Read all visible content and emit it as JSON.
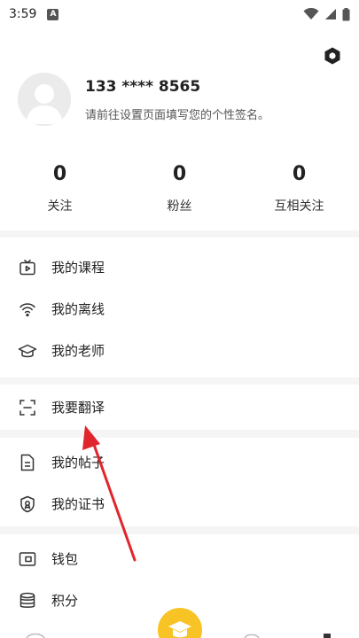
{
  "status_bar": {
    "time": "3:59",
    "notification_letter": "A"
  },
  "profile": {
    "name": "133 **** 8565",
    "signature": "请前往设置页面填写您的个性签名。",
    "stats": [
      {
        "value": "0",
        "label": "关注"
      },
      {
        "value": "0",
        "label": "粉丝"
      },
      {
        "value": "0",
        "label": "互相关注"
      }
    ]
  },
  "menu": {
    "courses": "我的课程",
    "offline": "我的离线",
    "teachers": "我的老师",
    "translate": "我要翻译",
    "posts": "我的帖子",
    "certificates": "我的证书",
    "wallet": "钱包",
    "points": "积分"
  },
  "colors": {
    "accent": "#f7c325",
    "annotation_arrow": "#e0262c"
  }
}
